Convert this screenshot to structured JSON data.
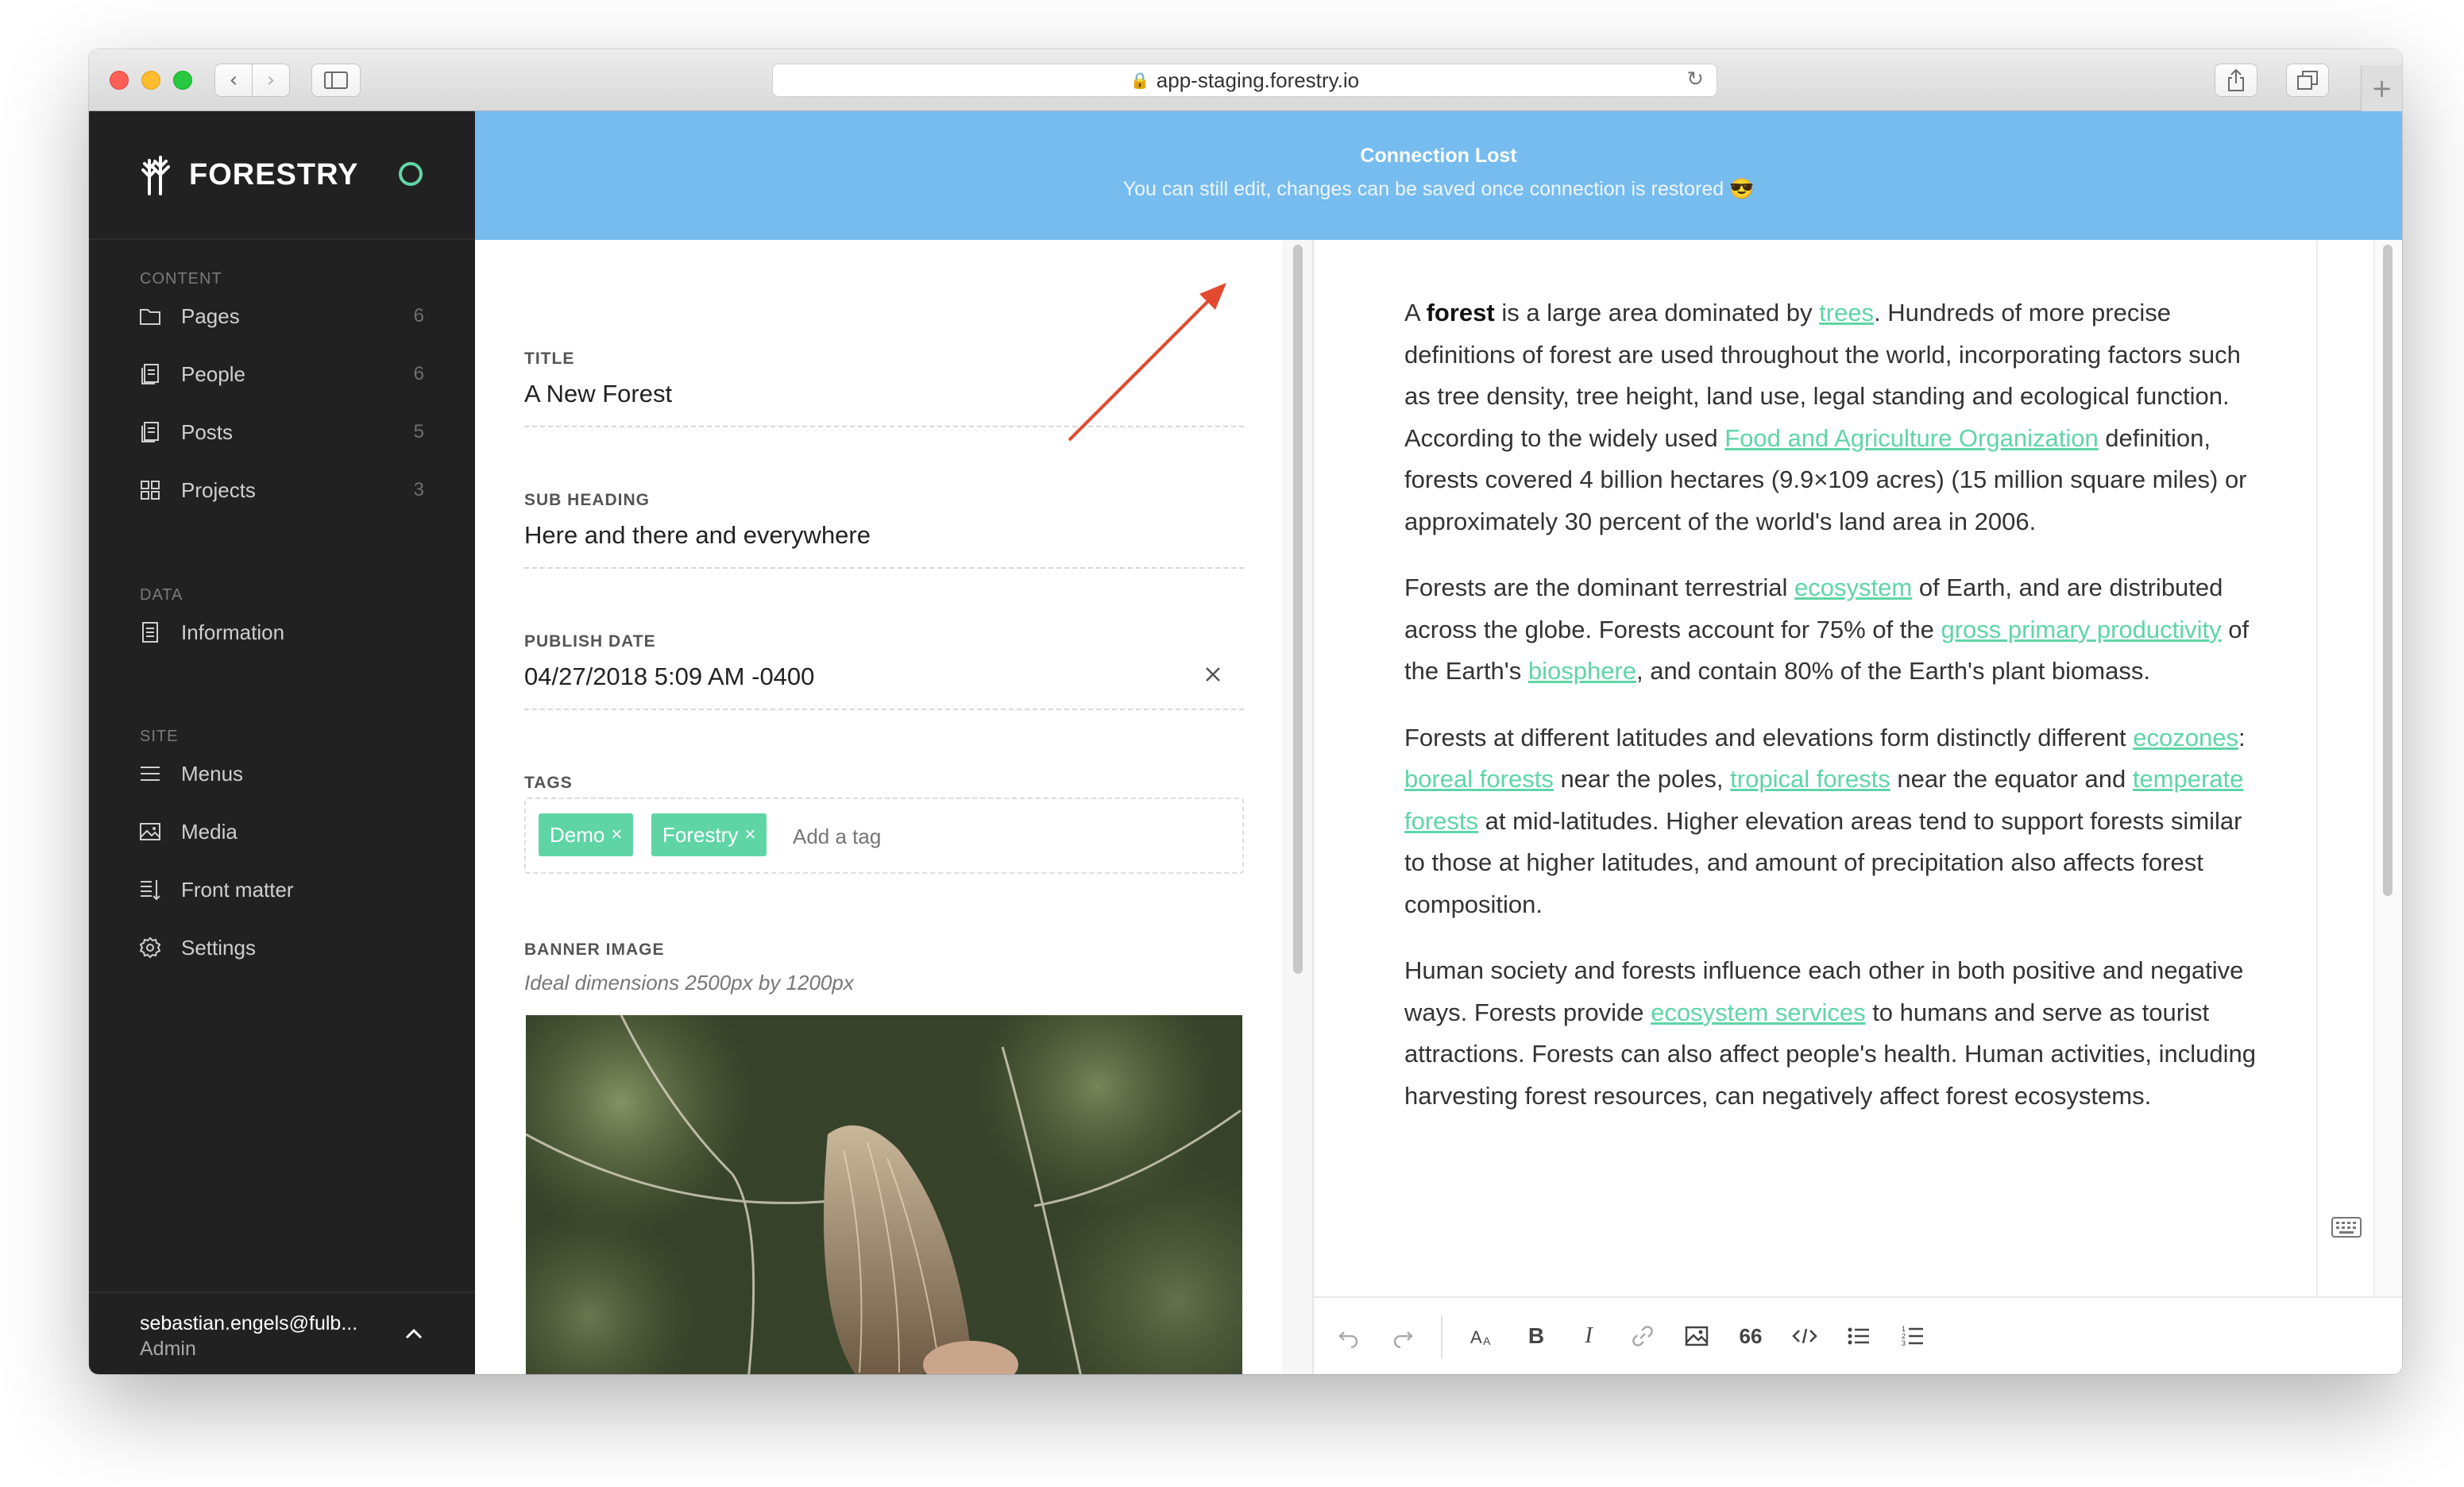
{
  "browser": {
    "url": "app-staging.forestry.io"
  },
  "sidebar": {
    "brand": "FORESTRY",
    "sections": {
      "content": "CONTENT",
      "data": "DATA",
      "site": "SITE"
    },
    "content_items": [
      {
        "label": "Pages",
        "count": "6",
        "icon": "folder-icon"
      },
      {
        "label": "People",
        "count": "6",
        "icon": "documents-icon"
      },
      {
        "label": "Posts",
        "count": "5",
        "icon": "documents-icon"
      },
      {
        "label": "Projects",
        "count": "3",
        "icon": "grid-icon"
      }
    ],
    "data_items": [
      {
        "label": "Information",
        "icon": "document-icon"
      }
    ],
    "site_items": [
      {
        "label": "Menus",
        "icon": "menu-icon"
      },
      {
        "label": "Media",
        "icon": "image-icon"
      },
      {
        "label": "Front matter",
        "icon": "front-matter-icon"
      },
      {
        "label": "Settings",
        "icon": "gear-icon"
      }
    ],
    "user": {
      "email": "sebastian.engels@fulb...",
      "role": "Admin"
    },
    "status_color": "#5fd5a6"
  },
  "banner": {
    "title": "Connection Lost",
    "message": "You can still edit, changes can be saved once connection is restored 😎",
    "color": "#77bcee"
  },
  "form": {
    "title_label": "TITLE",
    "title_value": "A New Forest",
    "subheading_label": "SUB HEADING",
    "subheading_value": "Here and there and everywhere",
    "publish_label": "PUBLISH DATE",
    "publish_value": "04/27/2018 5:09 AM -0400",
    "tags_label": "TAGS",
    "tags": [
      "Demo",
      "Forestry"
    ],
    "tag_placeholder": "Add a tag",
    "banner_label": "BANNER IMAGE",
    "banner_hint": "Ideal dimensions 2500px by 1200px",
    "accent": "#5fd5a6"
  },
  "editor": {
    "p1": {
      "a": "A ",
      "b": "forest",
      "c": " is a large area dominated by ",
      "l1": "trees",
      "d": ". Hundreds of more precise definitions of forest are used throughout the world, incorporating factors such as tree density, tree height, land use, legal standing and ecological function. According to the widely used ",
      "l2": "Food and Agriculture Organization",
      "e": " definition, forests covered 4 billion hectares (9.9×109 acres) (15 million square miles) or approximately 30 percent of the world's land area in 2006."
    },
    "p2": {
      "a": "Forests are the dominant terrestrial ",
      "l1": "ecosystem",
      "b": " of Earth, and are distributed across the globe. Forests account for 75% of the ",
      "l2": "gross primary productivity",
      "c": " of the Earth's ",
      "l3": "biosphere",
      "d": ", and contain 80% of the Earth's plant biomass."
    },
    "p3": {
      "a": "Forests at different latitudes and elevations form distinctly different ",
      "l1": "ecozones",
      "b": ": ",
      "l2": "boreal forests",
      "c": " near the poles, ",
      "l3": "tropical forests",
      "d": " near the equator and ",
      "l4": "temperate forests",
      "e": " at mid-latitudes. Higher elevation areas tend to support forests similar to those at higher latitudes, and amount of precipitation also affects forest composition."
    },
    "p4": {
      "a": "Human society and forests influence each other in both positive and negative ways. Forests provide ",
      "l1": "ecosystem services",
      "b": " to humans and serve as tourist attractions. Forests can also affect people's health. Human activities, including harvesting forest resources, can negatively affect forest ecosystems."
    },
    "toolbar": {
      "bold": "B",
      "italic": "I",
      "quote": "66"
    }
  }
}
